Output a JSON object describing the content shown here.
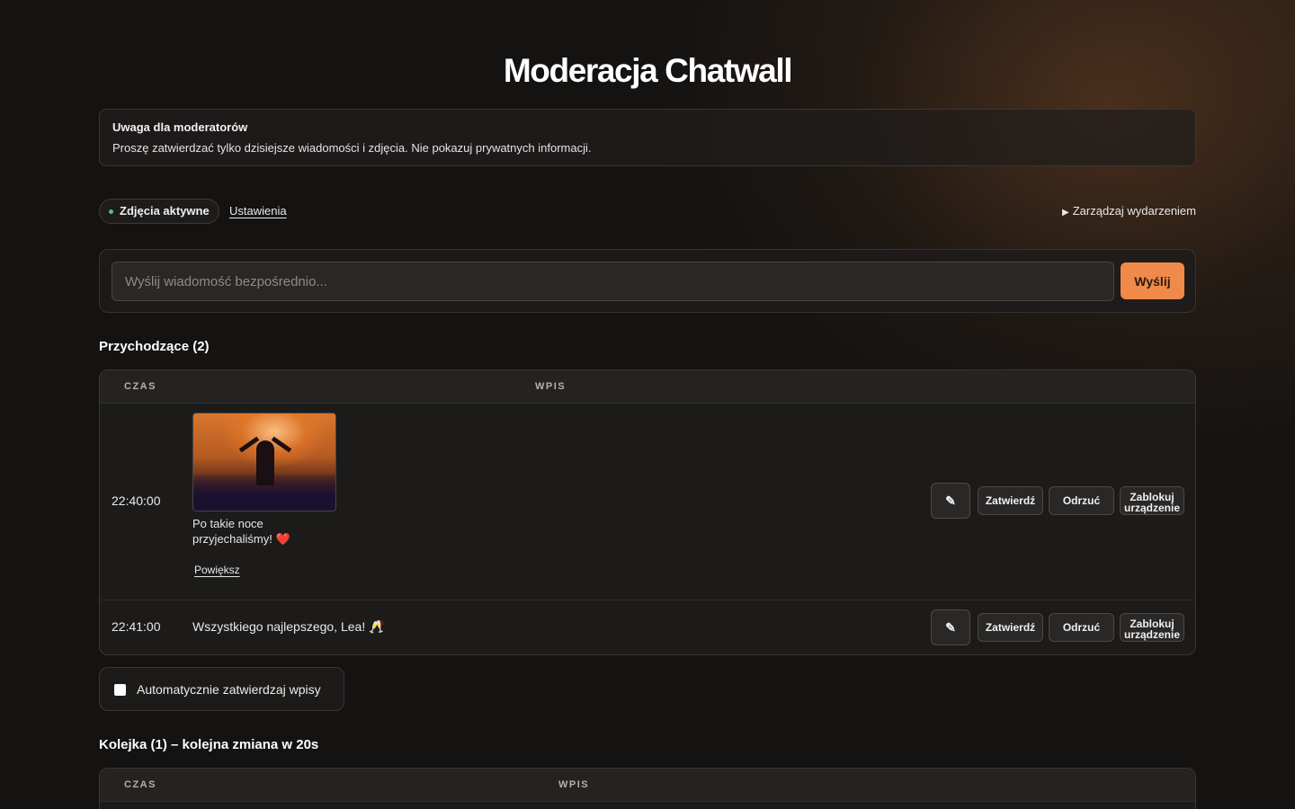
{
  "page": {
    "title": "Moderacja Chatwall"
  },
  "notice": {
    "title": "Uwaga dla moderatorów",
    "body": "Proszę zatwierdzać tylko dzisiejsze wiadomości i zdjęcia. Nie pokazuj prywatnych informacji."
  },
  "status": {
    "photos_label": "Zdjęcia aktywne",
    "photos_indicator_color": "#5fbf7a",
    "settings_link": "Ustawienia",
    "manage_label": "Zarządzaj wydarzeniem",
    "manage_icon": "triangle-right-icon"
  },
  "send": {
    "placeholder": "Wyślij wiadomość bezpośrednio...",
    "button_label": "Wyślij",
    "accent_color": "#f08a4a"
  },
  "incoming": {
    "title": "Przychodzące (2)",
    "columns": [
      "CZAS",
      "WPIS"
    ],
    "rows": [
      {
        "time": "22:40:00",
        "has_photo": true,
        "text": "Po takie noce przyjechaliśmy!",
        "emoji": "❤️",
        "enlarge_label": "Powiększ"
      },
      {
        "time": "22:41:00",
        "has_photo": false,
        "text": "Wszystkiego najlepszego, Lea! 🥂"
      }
    ],
    "actions": {
      "edit_icon": "pencil-icon",
      "approve": "Zatwierdź",
      "reject": "Odrzuć",
      "block_line1": "Zablokuj",
      "block_line2": "urządzenie"
    }
  },
  "auto_approve": {
    "label": "Automatycznie zatwierdzaj wpisy",
    "checked": false
  },
  "queue": {
    "title": "Kolejka (1) – kolejna zmiana w 20s",
    "columns": [
      "CZAS",
      "WPIS"
    ]
  }
}
